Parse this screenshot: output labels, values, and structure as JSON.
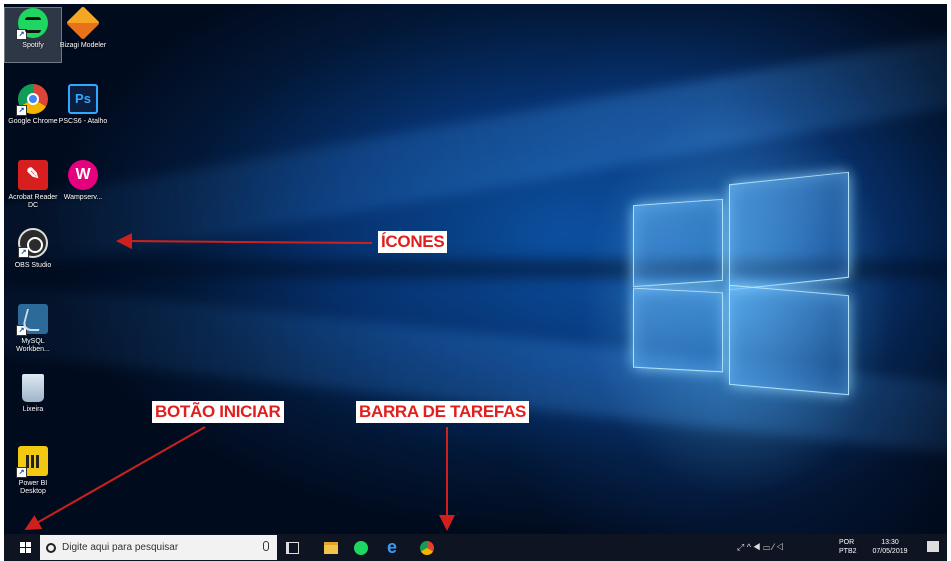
{
  "desktop": {
    "icons": [
      {
        "label": "Spotify",
        "icon": "spotify-icon"
      },
      {
        "label": "Bizagi Modeler",
        "icon": "bizagi-icon"
      },
      {
        "label": "Google Chrome",
        "icon": "chrome-icon"
      },
      {
        "label": "PSCS6 - Atalho",
        "icon": "photoshop-icon"
      },
      {
        "label": "Acrobat Reader DC",
        "icon": "acrobat-icon"
      },
      {
        "label": "Wampserv...",
        "icon": "wampserver-icon"
      },
      {
        "label": "OBS Studio",
        "icon": "obs-icon"
      },
      {
        "label": "MySQL Workben...",
        "icon": "mysql-workbench-icon"
      },
      {
        "label": "Lixeira",
        "icon": "recycle-bin-icon"
      },
      {
        "label": "Power BI Desktop",
        "icon": "powerbi-icon"
      }
    ],
    "ps_glyph": "Ps"
  },
  "annotations": {
    "icones": "ÍCONES",
    "botao_iniciar": "BOTÃO INICIAR",
    "barra_tarefas": "BARRA DE TAREFAS",
    "arrow_color": "#d0201e"
  },
  "taskbar": {
    "search_placeholder": "Digite aqui para pesquisar",
    "pinned": [
      "task-view-icon",
      "file-explorer-icon",
      "spotify-icon",
      "edge-icon",
      "chrome-icon"
    ],
    "edge_glyph": "e",
    "tray": {
      "lang_top": "POR",
      "lang_bottom": "PTB2",
      "time": "13:30",
      "date": "07/05/2019",
      "symbols": "⤢ ^ ◀ ▭ ⁄ ◁"
    }
  }
}
